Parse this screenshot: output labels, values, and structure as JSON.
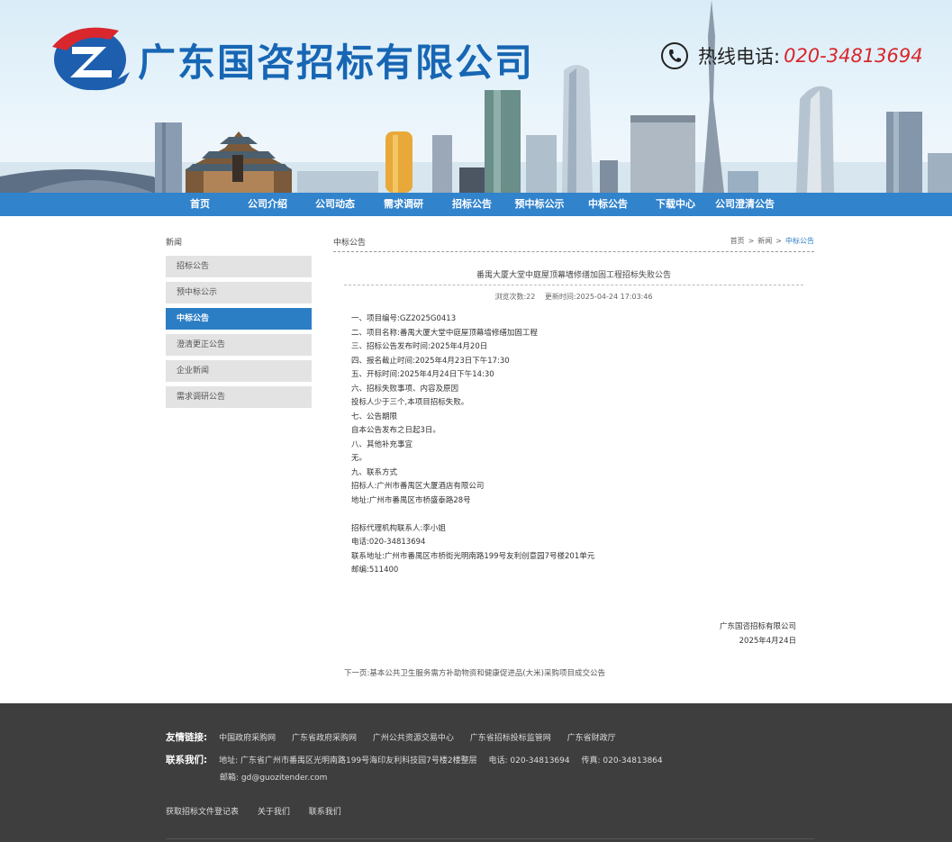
{
  "header": {
    "company_name": "广东国咨招标有限公司",
    "hotline_label": "热线电话:",
    "hotline_number": "020-34813694"
  },
  "colors": {
    "brand_blue": "#1766b4",
    "nav_blue": "#3183cc",
    "accent_red": "#d8272d",
    "footer_bg": "#3e3e3e"
  },
  "nav": {
    "items": [
      {
        "label": "首页"
      },
      {
        "label": "公司介绍"
      },
      {
        "label": "公司动态"
      },
      {
        "label": "需求调研"
      },
      {
        "label": "招标公告"
      },
      {
        "label": "预中标公示"
      },
      {
        "label": "中标公告"
      },
      {
        "label": "下载中心"
      },
      {
        "label": "公司澄清公告"
      }
    ]
  },
  "sidebar": {
    "title": "新闻",
    "items": [
      {
        "label": "招标公告"
      },
      {
        "label": "预中标公示"
      },
      {
        "label": "中标公告",
        "active": true
      },
      {
        "label": "澄清更正公告"
      },
      {
        "label": "企业新闻"
      },
      {
        "label": "需求调研公告"
      }
    ]
  },
  "main": {
    "section_title": "中标公告",
    "breadcrumb": [
      "首页",
      "新闻",
      "中标公告"
    ],
    "breadcrumb_sep": ">",
    "article": {
      "title": "番禺大厦大堂中庭屋顶幕墙修缮加固工程招标失败公告",
      "views_label": "浏览次数:22",
      "updated_label": "更新时间:2025-04-24 17:03:46",
      "lines": [
        "一、项目编号:GZ2025G0413",
        "二、项目名称:番禺大厦大堂中庭屋顶幕墙修缮加固工程",
        "三、招标公告发布时间:2025年4月20日",
        "四、报名截止时间:2025年4月23日下午17:30",
        "五、开标时间:2025年4月24日下午14:30",
        "六、招标失败事项、内容及原因",
        "投标人少于三个,本项目招标失败。",
        "七、公告期限",
        "自本公告发布之日起3日。",
        "八、其他补充事宜",
        "无。",
        "九、联系方式",
        "招标人:广州市番禺区大厦酒店有限公司",
        "地址:广州市番禺区市桥盛泰路28号",
        "",
        "招标代理机构联系人:李小姐",
        "电话:020-34813694",
        "联系地址:广州市番禺区市桥街光明南路199号友利创意园7号楼201单元",
        "邮编:511400"
      ],
      "signature_org": "广东国咨招标有限公司",
      "signature_date": "2025年4月24日",
      "next_label": "下一页:基本公共卫生服务需方补助物资和健康促进品(大米)采购项目成交公告"
    }
  },
  "footer": {
    "links_label": "友情链接:",
    "links": [
      "中国政府采购网",
      "广东省政府采购网",
      "广州公共资源交易中心",
      "广东省招标投标监管网",
      "广东省财政厅"
    ],
    "contact_label": "联系我们:",
    "address": "地址: 广东省广州市番禺区光明南路199号海印友利科技园7号楼2楼整层",
    "phone": "电话: 020-34813694",
    "fax": "传真: 020-34813864",
    "email": "邮箱: gd@guozitender.com",
    "bottom_links": [
      "获取招标文件登记表",
      "关于我们",
      "联系我们"
    ]
  }
}
